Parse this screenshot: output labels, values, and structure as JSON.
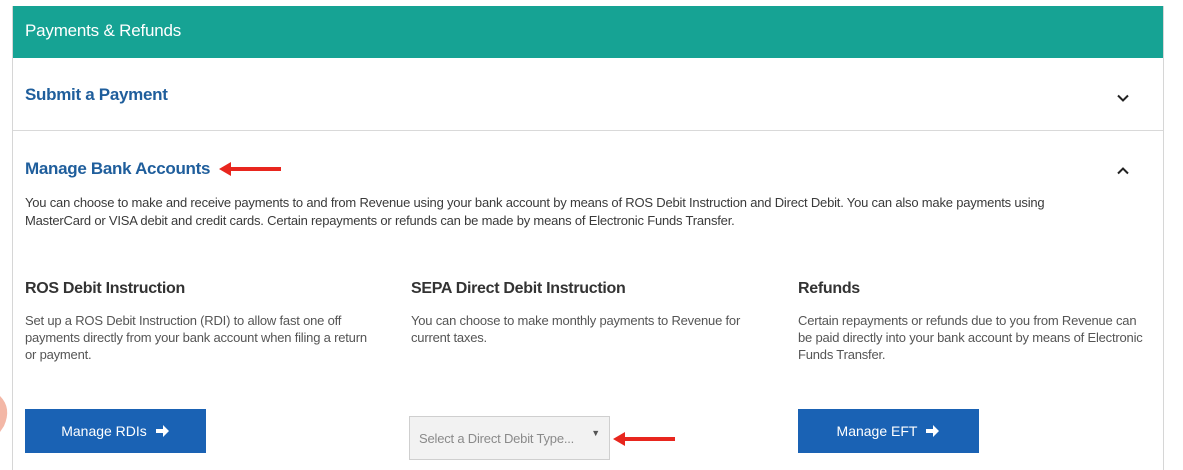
{
  "header": {
    "title": "Payments & Refunds"
  },
  "accordion": {
    "submit": {
      "title": "Submit a Payment",
      "icon": "chevron-down-icon"
    },
    "manage": {
      "title": "Manage Bank Accounts",
      "icon": "chevron-up-icon",
      "description": "You can choose to make and receive payments to and from Revenue using your bank account by means of ROS Debit Instruction and Direct Debit. You can also make payments using MasterCard or VISA debit and credit cards. Certain repayments or refunds can be made by means of Electronic Funds Transfer."
    }
  },
  "columns": {
    "ros": {
      "title": "ROS Debit Instruction",
      "text": "Set up a ROS Debit Instruction (RDI) to allow fast one off payments directly from your bank account when filing a return or payment.",
      "button_label": "Manage RDIs"
    },
    "sepa": {
      "title": "SEPA Direct Debit Instruction",
      "text": "You can choose to make monthly payments to Revenue for current taxes.",
      "select_placeholder": "Select a Direct Debit Type..."
    },
    "refunds": {
      "title": "Refunds",
      "text": "Certain repayments or refunds due to you from Revenue can be paid directly into your bank account by means of Electronic Funds Transfer.",
      "button_label": "Manage EFT"
    }
  },
  "colors": {
    "header_bg": "#16a394",
    "link": "#1f5e9c",
    "button_bg": "#1a62b4",
    "annotation_arrow": "#e8261e"
  }
}
